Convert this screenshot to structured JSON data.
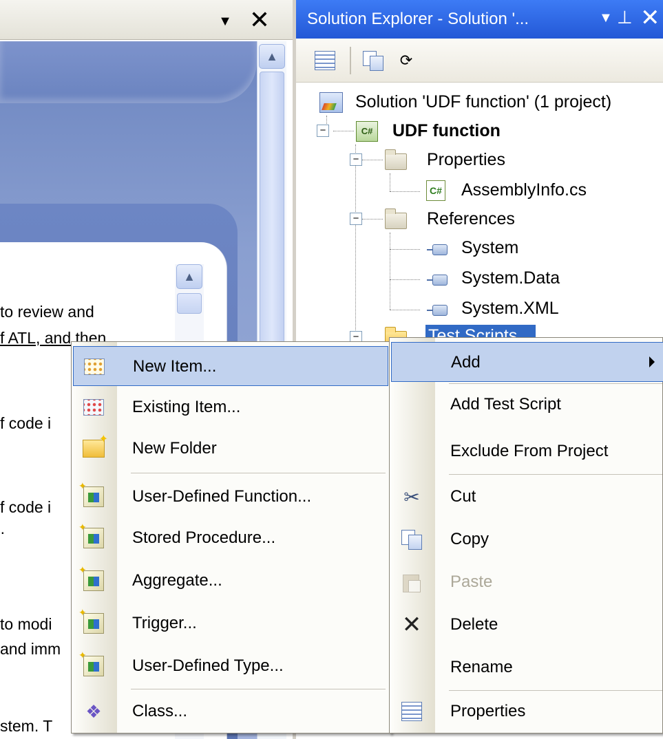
{
  "left_panel": {
    "dropdown_icon": "chevron-down-icon",
    "close_glyph": "✕",
    "snippets": [
      "to review and",
      "f ATL, and then",
      "f code i",
      "f code i",
      "·",
      "to modi",
      "and imm",
      "stem. T"
    ]
  },
  "solution_explorer": {
    "title": "Solution Explorer - Solution '...",
    "tree": {
      "solution": "Solution 'UDF function' (1 project)",
      "project": "UDF function",
      "properties_folder": "Properties",
      "assembly_info": "AssemblyInfo.cs",
      "references_folder": "References",
      "references": [
        "System",
        "System.Data",
        "System.XML"
      ],
      "selected_folder": "Test Scripts"
    }
  },
  "context_menu": {
    "items": [
      {
        "label": "Add",
        "has_submenu": true
      },
      {
        "label": "Add Test Script"
      },
      {
        "label": "Exclude From Project"
      },
      {
        "label": "Cut",
        "icon": "scissors-icon"
      },
      {
        "label": "Copy",
        "icon": "copy-icon"
      },
      {
        "label": "Paste",
        "icon": "paste-icon",
        "disabled": true
      },
      {
        "label": "Delete",
        "icon": "delete-icon"
      },
      {
        "label": "Rename"
      },
      {
        "label": "Properties",
        "icon": "properties-icon"
      }
    ]
  },
  "add_submenu": {
    "items": [
      {
        "label": "New Item...",
        "icon": "new-item-icon",
        "highlighted": true
      },
      {
        "label": "Existing Item...",
        "icon": "existing-item-icon"
      },
      {
        "label": "New Folder",
        "icon": "new-folder-icon"
      },
      {
        "label": "User-Defined Function...",
        "icon": "user-defined-function-icon"
      },
      {
        "label": "Stored Procedure...",
        "icon": "stored-procedure-icon"
      },
      {
        "label": "Aggregate...",
        "icon": "aggregate-icon"
      },
      {
        "label": "Trigger...",
        "icon": "trigger-icon"
      },
      {
        "label": "User-Defined Type...",
        "icon": "user-defined-type-icon"
      },
      {
        "label": "Class...",
        "icon": "class-icon"
      }
    ]
  }
}
